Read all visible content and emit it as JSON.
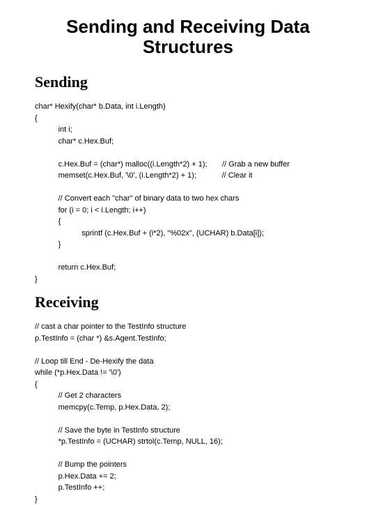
{
  "title": "Sending and Receiving Data Structures",
  "sections": {
    "sending": {
      "header": "Sending",
      "code": "char* Hexify(char* b.Data, int i.Length)\n{\n           int i;\n           char* c.Hex.Buf;\n\n           c.Hex.Buf = (char*) malloc((i.Length*2) + 1);       // Grab a new buffer\n           memset(c.Hex.Buf, '\\0', (i.Length*2) + 1);            // Clear it\n\n           // Convert each \"char\" of binary data to two hex chars\n           for (i = 0; i < i.Length; i++)\n           {\n                      sprintf (c.Hex.Buf + (i*2), \"%02x\", (UCHAR) b.Data[i]);\n           }\n\n           return c.Hex.Buf;\n}"
    },
    "receiving": {
      "header": "Receiving",
      "code": "// cast a char pointer to the TestInfo structure\np.TestInfo = (char *) &s.Agent.TestInfo;\n\n// Loop till End - De-Hexify the data\nwhile (*p.Hex.Data != '\\0')\n{\n           // Get 2 characters\n           memcpy(c.Temp, p.Hex.Data, 2);\n\n           // Save the byte in TestInfo structure\n           *p.TestInfo = (UCHAR) strtol(c.Temp, NULL, 16);\n\n           // Bump the pointers\n           p.Hex.Data += 2;\n           p.TestInfo ++;\n}"
    }
  }
}
